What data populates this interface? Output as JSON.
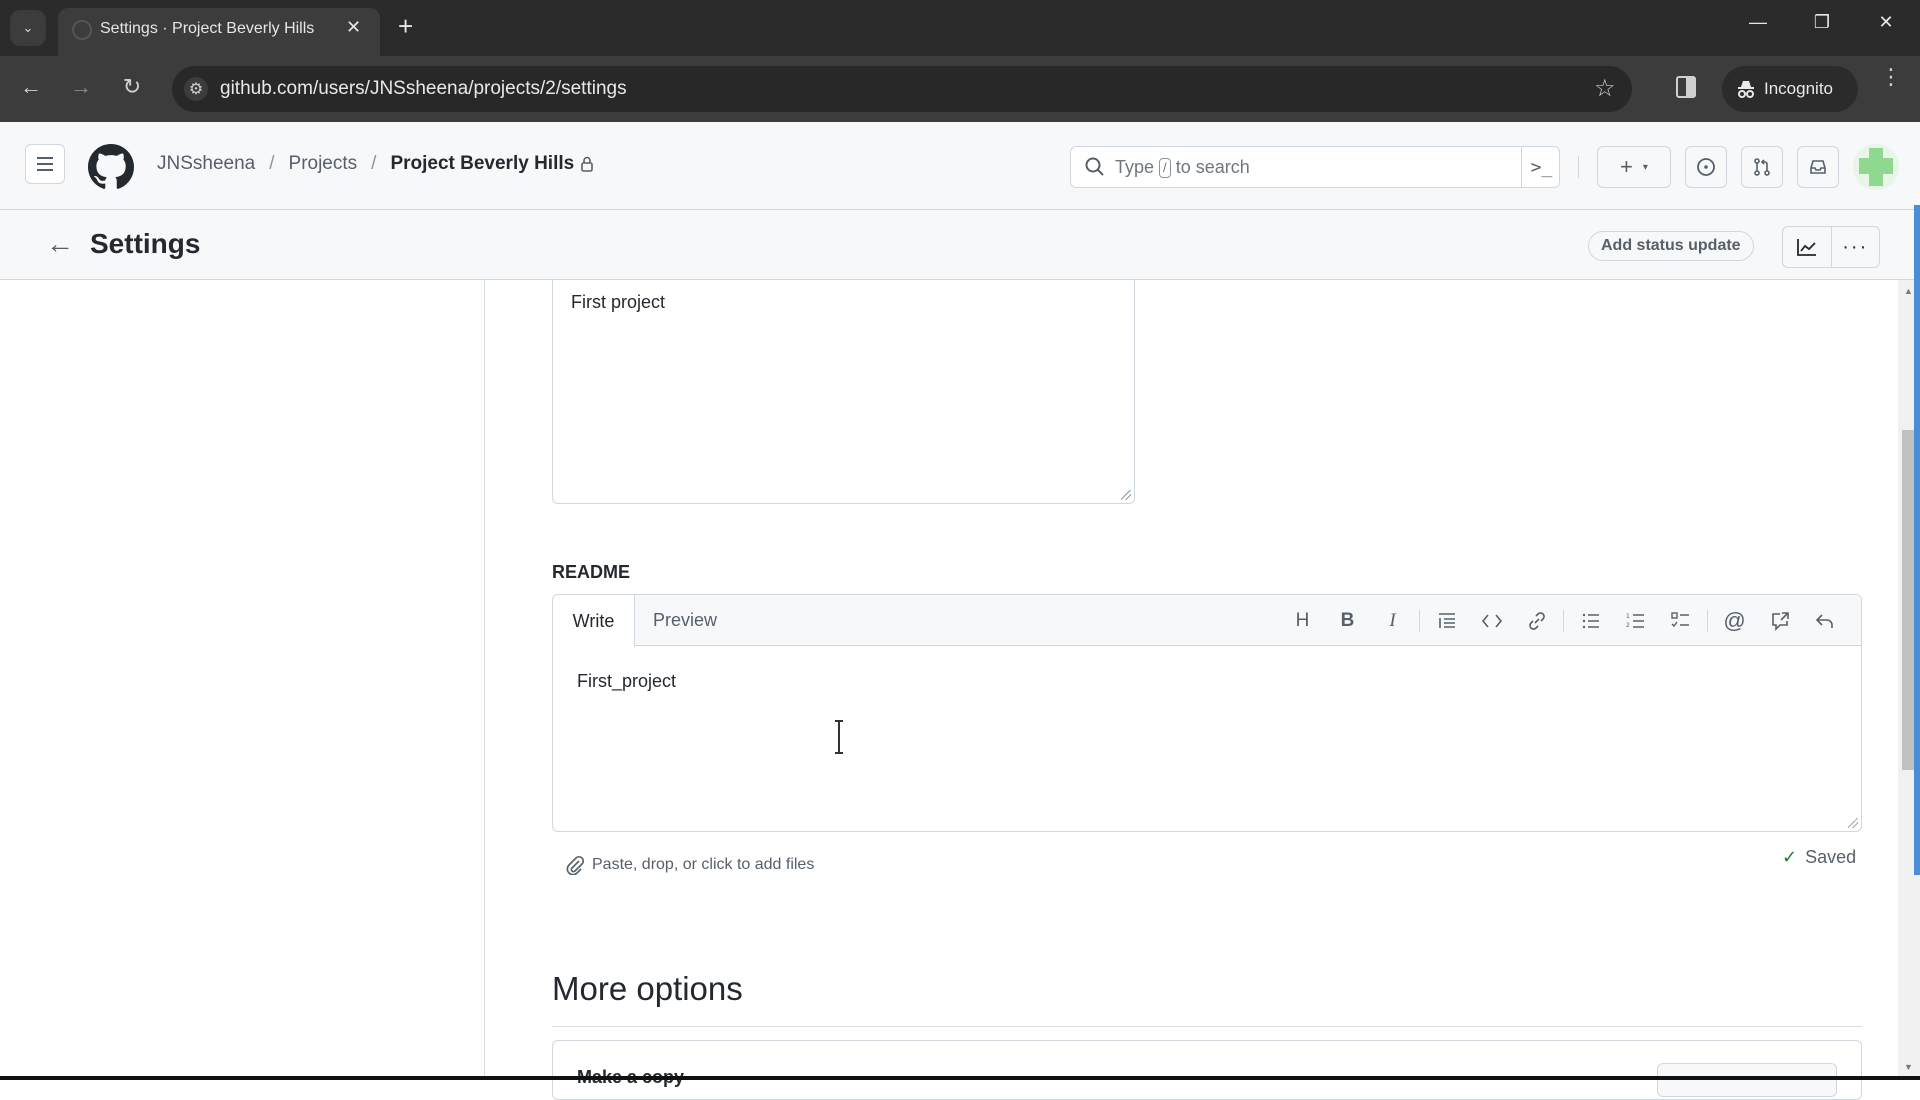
{
  "browser": {
    "tab_title": "Settings · Project Beverly Hills",
    "url": "github.com/users/JNSsheena/projects/2/settings",
    "incognito_label": "Incognito",
    "icons": {
      "tab_list": "chevron-down-icon",
      "close_tab": "close-icon",
      "new_tab": "plus-icon",
      "back": "arrow-left-icon",
      "forward": "arrow-right-icon",
      "reload": "reload-icon",
      "site_info": "tune-icon",
      "bookmark": "star-icon",
      "side_panel": "side-panel-icon",
      "incognito": "incognito-icon",
      "menu": "kebab-menu-icon"
    },
    "glyphs": {
      "tab_list": "⌄",
      "close": "✕",
      "new_tab": "+",
      "minimize": "—",
      "restore": "❐",
      "window_close": "✕",
      "back": "←",
      "forward": "→",
      "reload": "↻",
      "site_info": "⚙",
      "star": "☆",
      "menu": "⋮"
    }
  },
  "header": {
    "breadcrumb": [
      {
        "label": "JNSsheena"
      },
      {
        "label": "Projects"
      },
      {
        "label": "Project Beverly Hills",
        "locked": true
      }
    ],
    "separator": "/",
    "search": {
      "prefix": "Type",
      "key": "/",
      "suffix": "to search"
    },
    "command_palette_glyph": ">_",
    "create_glyph": "+",
    "caret_glyph": "▾",
    "avatar_color": "#8fd88f"
  },
  "settings_bar": {
    "back_glyph": "←",
    "title": "Settings",
    "status_button": "Add status update",
    "more_glyph": "···"
  },
  "short_description": {
    "value": "First project"
  },
  "readme": {
    "label": "README",
    "tabs": [
      {
        "label": "Write",
        "active": true
      },
      {
        "label": "Preview",
        "active": false
      }
    ],
    "toolbar": [
      {
        "name": "heading",
        "glyph": "H"
      },
      {
        "name": "bold",
        "glyph": "B"
      },
      {
        "name": "italic",
        "glyph": "I"
      },
      {
        "name": "quote",
        "glyph": "❝"
      },
      {
        "name": "code",
        "glyph": "‹›"
      },
      {
        "name": "link",
        "glyph": "🔗"
      },
      {
        "name": "unordered-list",
        "glyph": "☰"
      },
      {
        "name": "ordered-list",
        "glyph": "≡"
      },
      {
        "name": "task-list",
        "glyph": "☑"
      },
      {
        "name": "mention",
        "glyph": "@"
      },
      {
        "name": "reference",
        "glyph": "⇗"
      },
      {
        "name": "undo",
        "glyph": "↶"
      }
    ],
    "value": "First_project",
    "attach_hint": "Paste, drop, or click to add files",
    "saved_label": "Saved",
    "saved_glyph": "✓"
  },
  "more_options": {
    "title": "More options",
    "card_label": "Make a copy"
  },
  "scrollbar": {
    "up_glyph": "▲",
    "down_glyph": "▼"
  }
}
